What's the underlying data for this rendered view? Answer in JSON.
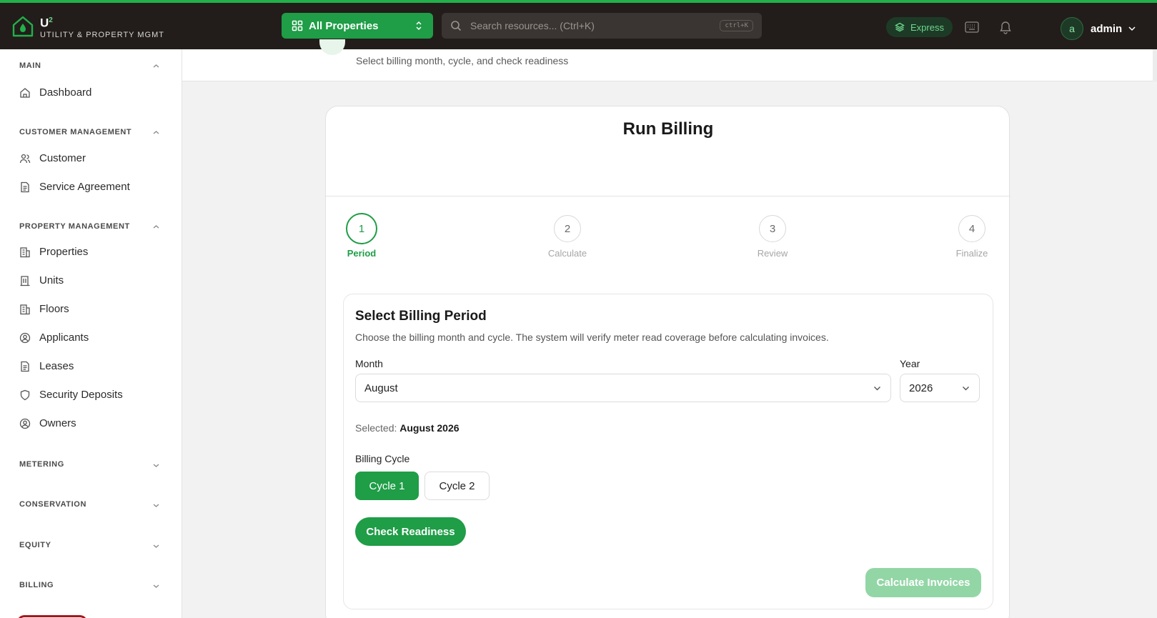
{
  "header": {
    "brand_title": "U",
    "brand_sup": "2",
    "brand_subtitle": "UTILITY & PROPERTY MGMT",
    "property_selector": "All Properties",
    "search_placeholder": "Search resources... (Ctrl+K)",
    "search_shortcut": "ctrl+K",
    "express_label": "Express",
    "user_initial": "a",
    "user_name": "admin"
  },
  "sidebar": {
    "sections": {
      "main": "MAIN",
      "customer": "CUSTOMER MANAGEMENT",
      "property": "PROPERTY MANAGEMENT",
      "metering": "METERING",
      "conservation": "CONSERVATION",
      "equity": "EQUITY",
      "billing": "BILLING"
    },
    "items": {
      "dashboard": "Dashboard",
      "customer": "Customer",
      "service_agreement": "Service Agreement",
      "properties": "Properties",
      "units": "Units",
      "floors": "Floors",
      "applicants": "Applicants",
      "leases": "Leases",
      "security_deposits": "Security Deposits",
      "owners": "Owners"
    }
  },
  "page": {
    "subtitle": "Select billing month, cycle, and check readiness",
    "card_title": "Run Billing"
  },
  "steps": [
    {
      "num": "1",
      "label": "Period"
    },
    {
      "num": "2",
      "label": "Calculate"
    },
    {
      "num": "3",
      "label": "Review"
    },
    {
      "num": "4",
      "label": "Finalize"
    }
  ],
  "panel": {
    "title": "Select Billing Period",
    "description": "Choose the billing month and cycle. The system will verify meter read coverage before calculating invoices.",
    "month_label": "Month",
    "month_value": "August",
    "year_label": "Year",
    "year_value": "2026",
    "selected_prefix": "Selected:",
    "selected_value": "August 2026",
    "cycle_label": "Billing Cycle",
    "cycle1": "Cycle 1",
    "cycle2": "Cycle 2",
    "check_button": "Check Readiness",
    "calculate_button": "Calculate Invoices"
  },
  "colors": {
    "accent": "#1f9d47",
    "topbar": "#221d1a",
    "disabled_button": "#93d6a6"
  }
}
